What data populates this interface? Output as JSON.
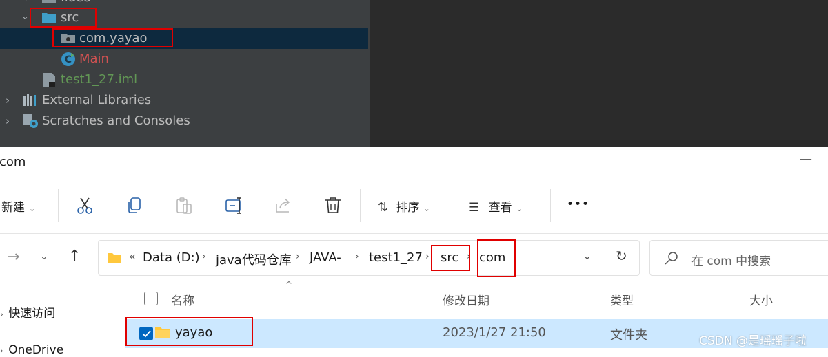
{
  "ide": {
    "tree": {
      "idea_label": ".idea",
      "src_label": "src",
      "package_label": "com.yayao",
      "main_label": "Main",
      "iml_label": "test1_27.iml",
      "ext_lib_label": "External Libraries",
      "scratches_label": "Scratches and Consoles"
    },
    "colors": {
      "main_class": "#d25252",
      "iml_file": "#629755",
      "selection": "#0d293e"
    }
  },
  "explorer": {
    "title": "com",
    "toolbar": {
      "new_label": "新建",
      "sort_label": "排序",
      "view_label": "查看",
      "more_label": "•••"
    },
    "address": {
      "overflow": "«",
      "crumbs": [
        "Data (D:)",
        "java代码仓库",
        "JAVA-",
        "test1_27",
        "src",
        "com"
      ]
    },
    "search_placeholder": "在 com 中搜索",
    "columns": {
      "name": "名称",
      "modified": "修改日期",
      "type": "类型",
      "size": "大小"
    },
    "rows": [
      {
        "name": "yayao",
        "modified": "2023/1/27 21:50",
        "type": "文件夹"
      }
    ],
    "nav_pane": {
      "quick_access": "快速访问",
      "onedrive": "OneDrive"
    },
    "colors": {
      "row_selected": "#cce8ff",
      "checkbox": "#0067c0",
      "folder": "#ffc83d"
    }
  },
  "watermark": "CSDN @是瑶瑶子啦"
}
